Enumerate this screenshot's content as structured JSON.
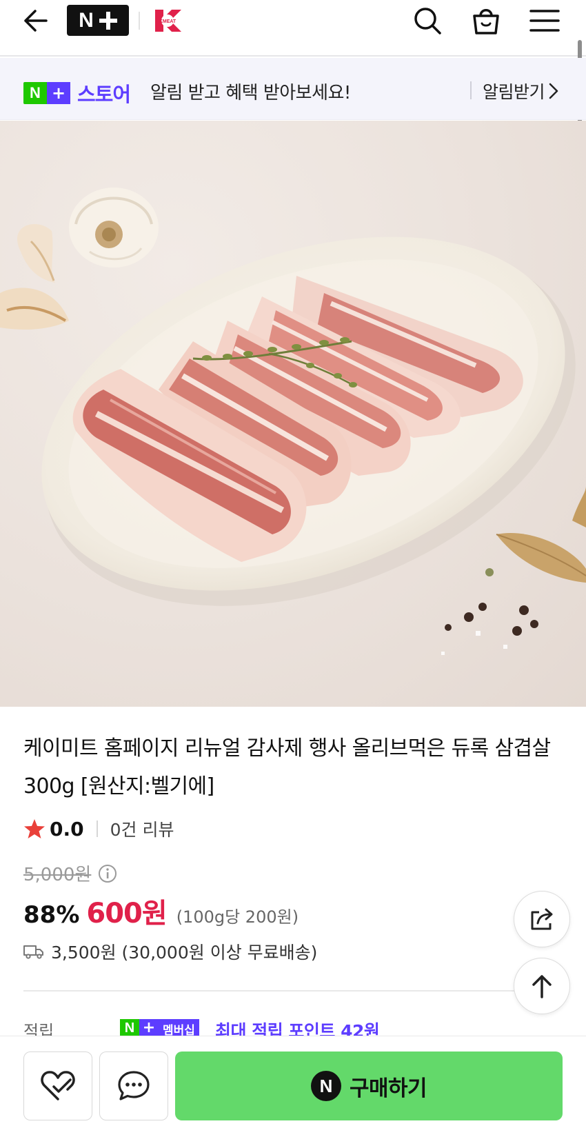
{
  "header": {
    "logo_text": "N+",
    "brand_logo_text": "KMEAT",
    "icons": [
      "back-arrow-icon",
      "search-icon",
      "shopping-bag-icon",
      "hamburger-menu-icon"
    ]
  },
  "banner": {
    "badge_text": "스토어",
    "message": "알림 받고 혜택 받아보세요!",
    "link_label": "알림받기"
  },
  "product": {
    "title": "케이미트 홈페이지 리뉴얼 감사제 행사 올리브먹은 듀록 삼겹살 300g [원산지:벨기에]",
    "rating": "0.0",
    "review_count": "0건 리뷰",
    "original_price": "5,000원",
    "discount_rate": "88%",
    "sale_price": "600원",
    "unit_price": "(100g당 200원)",
    "shipping": "3,500원 (30,000원 이상 무료배송)"
  },
  "points": {
    "label": "적립",
    "membership_badge": "멤버십",
    "text": "최대 적립 포인트 42원"
  },
  "bottom_bar": {
    "buy_label": "구매하기"
  },
  "colors": {
    "accent_purple": "#5d3dff",
    "naver_green": "#1ec800",
    "buy_button": "#63d96a",
    "sale_red": "#e0214a",
    "banner_bg": "#f4f4fb"
  }
}
